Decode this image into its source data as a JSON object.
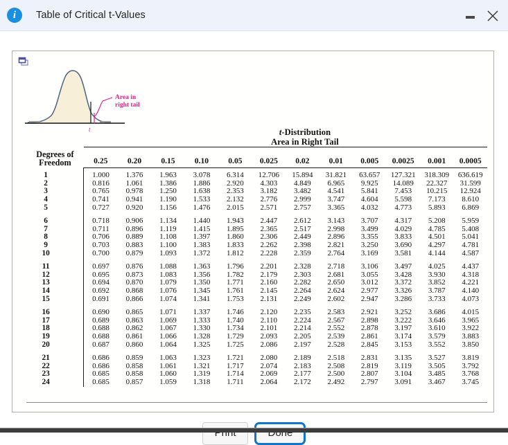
{
  "window": {
    "title": "Table of Critical t-Values",
    "info_icon": "info-icon",
    "minimize_label": "–",
    "close_label": "✕"
  },
  "panel": {
    "copy_icon": "copy-window-icon"
  },
  "figure": {
    "annotation_line1": "Area in",
    "annotation_line2": "right tail",
    "axis_label": "t",
    "curve_color": "#4a6282",
    "fill_color": "#f7efd7",
    "annotation_color": "#e0218a"
  },
  "table_heading": {
    "line1_italic": "t",
    "line1_rest": "-Distribution",
    "line2": "Area in Right Tail"
  },
  "chart_data": {
    "type": "table",
    "title": "t-Distribution Area in Right Tail",
    "row_header_line1": "Degrees of",
    "row_header_line2": "Freedom",
    "columns": [
      "0.25",
      "0.20",
      "0.15",
      "0.10",
      "0.05",
      "0.025",
      "0.02",
      "0.01",
      "0.005",
      "0.0025",
      "0.001",
      "0.0005"
    ],
    "rows": [
      {
        "df": "1",
        "values": [
          "1.000",
          "1.376",
          "1.963",
          "3.078",
          "6.314",
          "12.706",
          "15.894",
          "31.821",
          "63.657",
          "127.321",
          "318.309",
          "636.619"
        ]
      },
      {
        "df": "2",
        "values": [
          "0.816",
          "1.061",
          "1.386",
          "1.886",
          "2.920",
          "4.303",
          "4.849",
          "6.965",
          "9.925",
          "14.089",
          "22.327",
          "31.599"
        ]
      },
      {
        "df": "3",
        "values": [
          "0.765",
          "0.978",
          "1.250",
          "1.638",
          "2.353",
          "3.182",
          "3.482",
          "4.541",
          "5.841",
          "7.453",
          "10.215",
          "12.924"
        ]
      },
      {
        "df": "4",
        "values": [
          "0.741",
          "0.941",
          "1.190",
          "1.533",
          "2.132",
          "2.776",
          "2.999",
          "3.747",
          "4.604",
          "5.598",
          "7.173",
          "8.610"
        ]
      },
      {
        "df": "5",
        "values": [
          "0.727",
          "0.920",
          "1.156",
          "1.476",
          "2.015",
          "2.571",
          "2.757",
          "3.365",
          "4.032",
          "4.773",
          "5.893",
          "6.869"
        ]
      },
      {
        "df": "6",
        "values": [
          "0.718",
          "0.906",
          "1.134",
          "1.440",
          "1.943",
          "2.447",
          "2.612",
          "3.143",
          "3.707",
          "4.317",
          "5.208",
          "5.959"
        ]
      },
      {
        "df": "7",
        "values": [
          "0.711",
          "0.896",
          "1.119",
          "1.415",
          "1.895",
          "2.365",
          "2.517",
          "2.998",
          "3.499",
          "4.029",
          "4.785",
          "5.408"
        ]
      },
      {
        "df": "8",
        "values": [
          "0.706",
          "0.889",
          "1.108",
          "1.397",
          "1.860",
          "2.306",
          "2.449",
          "2.896",
          "3.355",
          "3.833",
          "4.501",
          "5.041"
        ]
      },
      {
        "df": "9",
        "values": [
          "0.703",
          "0.883",
          "1.100",
          "1.383",
          "1.833",
          "2.262",
          "2.398",
          "2.821",
          "3.250",
          "3.690",
          "4.297",
          "4.781"
        ]
      },
      {
        "df": "10",
        "values": [
          "0.700",
          "0.879",
          "1.093",
          "1.372",
          "1.812",
          "2.228",
          "2.359",
          "2.764",
          "3.169",
          "3.581",
          "4.144",
          "4.587"
        ]
      },
      {
        "df": "11",
        "values": [
          "0.697",
          "0.876",
          "1.088",
          "1.363",
          "1.796",
          "2.201",
          "2.328",
          "2.718",
          "3.106",
          "3.497",
          "4.025",
          "4.437"
        ]
      },
      {
        "df": "12",
        "values": [
          "0.695",
          "0.873",
          "1.083",
          "1.356",
          "1.782",
          "2.179",
          "2.303",
          "2.681",
          "3.055",
          "3.428",
          "3.930",
          "4.318"
        ]
      },
      {
        "df": "13",
        "values": [
          "0.694",
          "0.870",
          "1.079",
          "1.350",
          "1.771",
          "2.160",
          "2.282",
          "2.650",
          "3.012",
          "3.372",
          "3.852",
          "4.221"
        ]
      },
      {
        "df": "14",
        "values": [
          "0.692",
          "0.868",
          "1.076",
          "1.345",
          "1.761",
          "2.145",
          "2.264",
          "2.624",
          "2.977",
          "3.326",
          "3.787",
          "4.140"
        ]
      },
      {
        "df": "15",
        "values": [
          "0.691",
          "0.866",
          "1.074",
          "1.341",
          "1.753",
          "2.131",
          "2.249",
          "2.602",
          "2.947",
          "3.286",
          "3.733",
          "4.073"
        ]
      },
      {
        "df": "16",
        "values": [
          "0.690",
          "0.865",
          "1.071",
          "1.337",
          "1.746",
          "2.120",
          "2.235",
          "2.583",
          "2.921",
          "3.252",
          "3.686",
          "4.015"
        ]
      },
      {
        "df": "17",
        "values": [
          "0.689",
          "0.863",
          "1.069",
          "1.333",
          "1.740",
          "2.110",
          "2.224",
          "2.567",
          "2.898",
          "3.222",
          "3.646",
          "3.965"
        ]
      },
      {
        "df": "18",
        "values": [
          "0.688",
          "0.862",
          "1.067",
          "1.330",
          "1.734",
          "2.101",
          "2.214",
          "2.552",
          "2.878",
          "3.197",
          "3.610",
          "3.922"
        ]
      },
      {
        "df": "19",
        "values": [
          "0.688",
          "0.861",
          "1.066",
          "1.328",
          "1.729",
          "2.093",
          "2.205",
          "2.539",
          "2.861",
          "3.174",
          "3.579",
          "3.883"
        ]
      },
      {
        "df": "20",
        "values": [
          "0.687",
          "0.860",
          "1.064",
          "1.325",
          "1.725",
          "2.086",
          "2.197",
          "2.528",
          "2.845",
          "3.153",
          "3.552",
          "3.850"
        ]
      },
      {
        "df": "21",
        "values": [
          "0.686",
          "0.859",
          "1.063",
          "1.323",
          "1.721",
          "2.080",
          "2.189",
          "2.518",
          "2.831",
          "3.135",
          "3.527",
          "3.819"
        ]
      },
      {
        "df": "22",
        "values": [
          "0.686",
          "0.858",
          "1.061",
          "1.321",
          "1.717",
          "2.074",
          "2.183",
          "2.508",
          "2.819",
          "3.119",
          "3.505",
          "3.792"
        ]
      },
      {
        "df": "23",
        "values": [
          "0.685",
          "0.858",
          "1.060",
          "1.319",
          "1.714",
          "2.069",
          "2.177",
          "2.500",
          "2.807",
          "3.104",
          "3.485",
          "3.768"
        ]
      },
      {
        "df": "24",
        "values": [
          "0.685",
          "0.857",
          "1.059",
          "1.318",
          "1.711",
          "2.064",
          "2.172",
          "2.492",
          "2.797",
          "3.091",
          "3.467",
          "3.745"
        ]
      }
    ]
  },
  "footer": {
    "print_label": "Print",
    "done_label": "Done",
    "primary_color": "#1176c7"
  }
}
